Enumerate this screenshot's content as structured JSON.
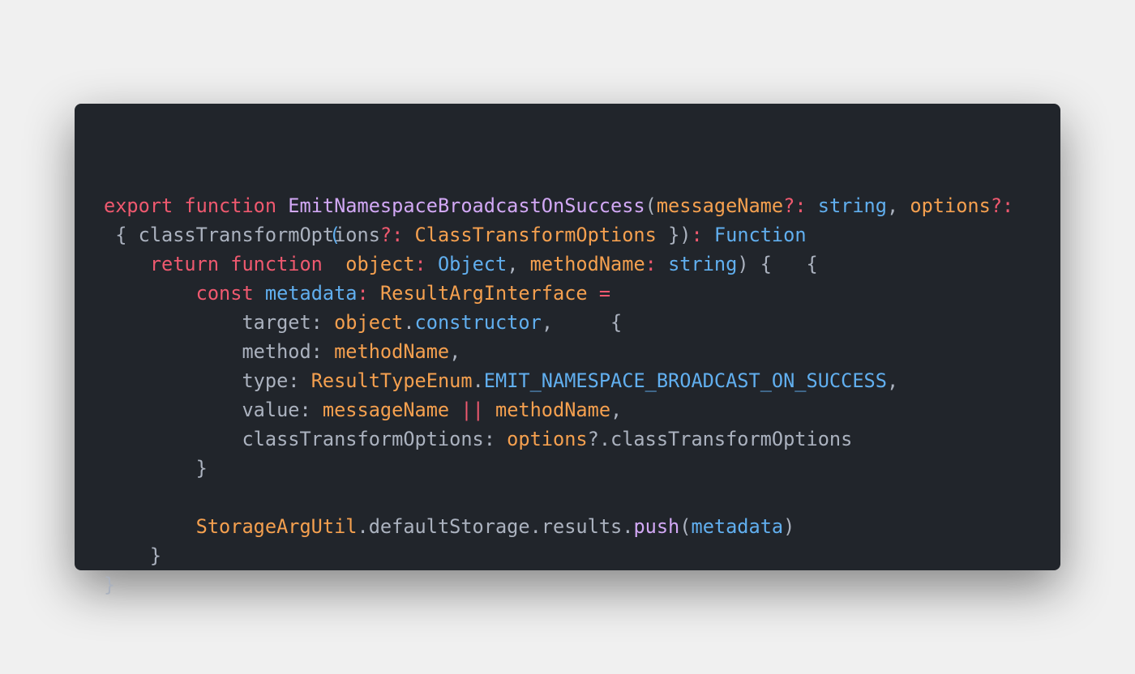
{
  "colors": {
    "background": "#f0f0f0",
    "editor": "#21252b",
    "keyword": "#ef596f",
    "function": "#d2a8f5",
    "param": "#f5a04f",
    "type": "#61afef",
    "plain": "#abb2bf"
  },
  "code_lines": [
    [
      [
        "export function ",
        "kw"
      ],
      [
        "EmitNamespaceBroadcastOnSuccess",
        "fn"
      ],
      [
        "(",
        "pl"
      ],
      [
        "messageName",
        "or"
      ],
      [
        "?:",
        "kw"
      ],
      [
        " string",
        "bl"
      ],
      [
        ", ",
        "pl"
      ],
      [
        "options",
        "or"
      ],
      [
        "?:",
        "kw"
      ]
    ],
    [
      [
        " { classTransformOptions",
        "pl"
      ],
      [
        "?:",
        "kw"
      ],
      [
        " ClassTransformOptions",
        "or"
      ],
      [
        " })",
        "pl"
      ],
      [
        ":",
        "kw"
      ],
      [
        " Function",
        "bl"
      ]
    ],
    [
      [
        "    return function ",
        "kw"
      ],
      [
        " object",
        "or"
      ],
      [
        ":",
        "kw"
      ],
      [
        " Object",
        "bl"
      ],
      [
        ", ",
        "pl"
      ],
      [
        "methodName",
        "or"
      ],
      [
        ":",
        "kw"
      ],
      [
        " string",
        "bl"
      ],
      [
        ") {   {",
        "pl"
      ]
    ],
    [
      [
        "        const ",
        "kw"
      ],
      [
        "metadata",
        "bl"
      ],
      [
        ":",
        "kw"
      ],
      [
        " ResultArgInterface",
        "or"
      ],
      [
        " =",
        "kw"
      ]
    ],
    [
      [
        "            target: ",
        "pl"
      ],
      [
        "object",
        "or"
      ],
      [
        ".",
        "pl"
      ],
      [
        "constructor",
        "bl"
      ],
      [
        ",     {",
        "pl"
      ]
    ],
    [
      [
        "            method: ",
        "pl"
      ],
      [
        "methodName",
        "or"
      ],
      [
        ",",
        "pl"
      ]
    ],
    [
      [
        "            type: ",
        "pl"
      ],
      [
        "ResultTypeEnum",
        "or"
      ],
      [
        ".",
        "pl"
      ],
      [
        "EMIT_NAMESPACE_BROADCAST_ON_SUCCESS",
        "bl"
      ],
      [
        ",",
        "pl"
      ]
    ],
    [
      [
        "            value: ",
        "pl"
      ],
      [
        "messageName",
        "or"
      ],
      [
        " ||",
        "kw"
      ],
      [
        " methodName",
        "or"
      ],
      [
        ",",
        "pl"
      ]
    ],
    [
      [
        "            classTransformOptions: ",
        "pl"
      ],
      [
        "options",
        "or"
      ],
      [
        "?.classTransformOptions",
        "pl"
      ]
    ],
    [
      [
        "        }",
        "pl"
      ]
    ],
    [],
    [
      [
        "        ",
        "pl"
      ],
      [
        "StorageArgUtil",
        "or"
      ],
      [
        ".defaultStorage.results.",
        "pl"
      ],
      [
        "push",
        "fn"
      ],
      [
        "(",
        "pl"
      ],
      [
        "metadata",
        "bl"
      ],
      [
        ")",
        "pl"
      ]
    ],
    [
      [
        "    }",
        "pl"
      ]
    ],
    [
      [
        "}",
        "pl"
      ]
    ]
  ],
  "overlay_paren": "("
}
